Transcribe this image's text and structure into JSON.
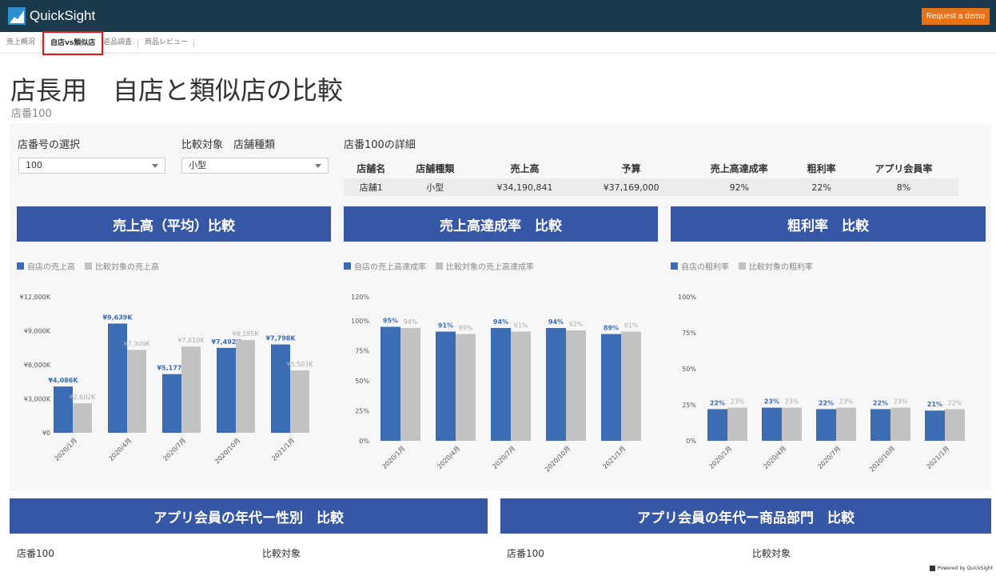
{
  "header": {
    "logo_text": "QuickSight",
    "demo_button": "Request a demo"
  },
  "tabs": [
    {
      "label": "売上概況"
    },
    {
      "label": "自店vs類似店"
    },
    {
      "label": "返品調査"
    },
    {
      "label": "商品レビュー"
    }
  ],
  "page": {
    "title": "店長用　自店と類似店の比較",
    "subtitle": "店番100"
  },
  "controls": {
    "store_label": "店番号の選択",
    "store_value": "100",
    "compare_label": "比較対象　店舗種類",
    "compare_value": "小型"
  },
  "detail": {
    "title": "店番100の詳細",
    "headers": [
      "店舗名",
      "店舗種類",
      "売上高",
      "予算",
      "売上高達成率",
      "粗利率",
      "アプリ会員率"
    ],
    "row": [
      "店舗1",
      "小型",
      "¥34,190,841",
      "¥37,169,000",
      "92%",
      "22%",
      "8%"
    ]
  },
  "colors": {
    "own": "#3c6db4",
    "compare": "#c2c2c2",
    "banner": "#3656a6",
    "header_bg": "#1b3a4b",
    "demo_bg": "#ec7211"
  },
  "chart_data": [
    {
      "type": "bar",
      "title": "売上高（平均）比較",
      "categories": [
        "2020/1月",
        "2020/4月",
        "2020/7月",
        "2020/10月",
        "2021/1月"
      ],
      "series": [
        {
          "name": "自店の売上高",
          "values": [
            4086,
            9639,
            5177,
            7492,
            7798
          ],
          "labels": [
            "¥4,086K",
            "¥9,639K",
            "¥5,177K",
            "¥7,492K",
            "¥7,798K"
          ]
        },
        {
          "name": "比較対象の売上高",
          "values": [
            2602,
            7309,
            7610,
            8185,
            5503
          ],
          "labels": [
            "¥2,602K",
            "¥7,309K",
            "¥7,610K",
            "¥8,185K",
            "¥5,503K"
          ]
        }
      ],
      "ylim": [
        0,
        12000
      ],
      "yticks": [
        0,
        3000,
        6000,
        9000,
        12000
      ],
      "ytick_labels": [
        "¥0",
        "¥3,000K",
        "¥6,000K",
        "¥9,000K",
        "¥12,000K"
      ],
      "legend": "top-left"
    },
    {
      "type": "bar",
      "title": "売上高達成率　比較",
      "categories": [
        "2020/1月",
        "2020/4月",
        "2020/7月",
        "2020/10月",
        "2021/1月"
      ],
      "series": [
        {
          "name": "自店の売上高達成率",
          "values": [
            95,
            91,
            94,
            94,
            89
          ],
          "labels": [
            "95%",
            "91%",
            "94%",
            "94%",
            "89%"
          ]
        },
        {
          "name": "比較対象の売上高達成率",
          "values": [
            94,
            89,
            91,
            92,
            91
          ],
          "labels": [
            "94%",
            "89%",
            "91%",
            "92%",
            "91%"
          ]
        }
      ],
      "ylim": [
        0,
        120
      ],
      "yticks": [
        0,
        25,
        50,
        75,
        100,
        120
      ],
      "ytick_labels": [
        "0%",
        "25%",
        "50%",
        "75%",
        "100%",
        "120%"
      ],
      "legend": "top-left"
    },
    {
      "type": "bar",
      "title": "粗利率　比較",
      "categories": [
        "2020/1月",
        "2020/4月",
        "2020/7月",
        "2020/10月",
        "2021/1月"
      ],
      "series": [
        {
          "name": "自店の粗利率",
          "values": [
            22,
            23,
            22,
            22,
            21
          ],
          "labels": [
            "22%",
            "23%",
            "22%",
            "22%",
            "21%"
          ]
        },
        {
          "name": "比較対象の粗利率",
          "values": [
            23,
            23,
            23,
            23,
            22
          ],
          "labels": [
            "23%",
            "23%",
            "23%",
            "23%",
            "22%"
          ]
        }
      ],
      "ylim": [
        0,
        100
      ],
      "yticks": [
        0,
        25,
        50,
        75,
        100
      ],
      "ytick_labels": [
        "0%",
        "25%",
        "50%",
        "75%",
        "100%"
      ],
      "legend": "top-left"
    }
  ],
  "bottom": {
    "left_banner": "アプリ会員の年代ー性別　比較",
    "right_banner": "アプリ会員の年代ー商品部門　比較",
    "left_store": "店番100",
    "left_compare": "比較対象",
    "right_store": "店番100",
    "right_compare": "比較対象"
  },
  "footer": {
    "powered": "Powered by QuickSight"
  }
}
